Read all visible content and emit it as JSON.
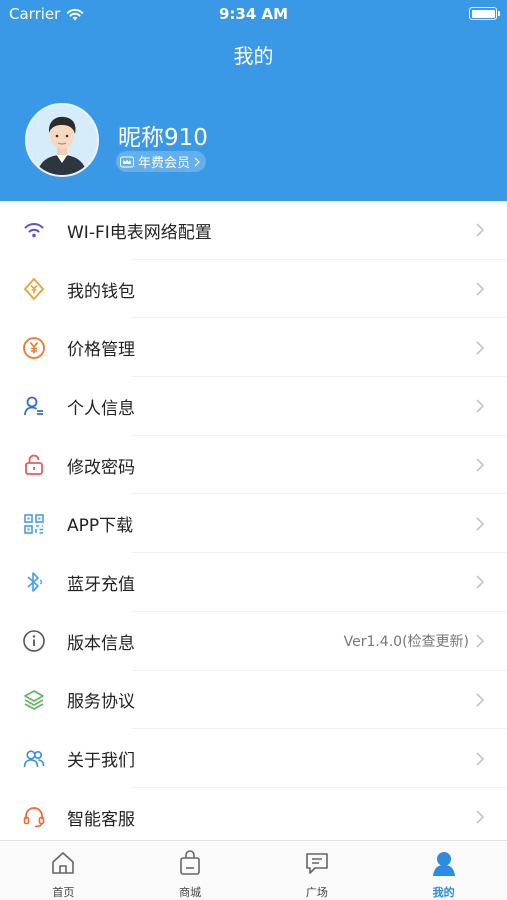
{
  "status_bar": {
    "carrier": "Carrier",
    "time": "9:34 AM"
  },
  "header": {
    "title": "我的"
  },
  "profile": {
    "nickname": "昵称910",
    "membership": "年费会员"
  },
  "menu": [
    {
      "label": "WI-FI电表网络配置",
      "icon": "wifi-icon",
      "right": ""
    },
    {
      "label": "我的钱包",
      "icon": "wallet-icon",
      "right": ""
    },
    {
      "label": "价格管理",
      "icon": "yen-icon",
      "right": ""
    },
    {
      "label": "个人信息",
      "icon": "user-info-icon",
      "right": ""
    },
    {
      "label": "修改密码",
      "icon": "lock-icon",
      "right": ""
    },
    {
      "label": "APP下载",
      "icon": "qrcode-icon",
      "right": ""
    },
    {
      "label": "蓝牙充值",
      "icon": "bluetooth-icon",
      "right": ""
    },
    {
      "label": "版本信息",
      "icon": "info-icon",
      "right": "Ver1.4.0(检查更新)"
    },
    {
      "label": "服务协议",
      "icon": "layers-icon",
      "right": ""
    },
    {
      "label": "关于我们",
      "icon": "group-icon",
      "right": ""
    },
    {
      "label": "智能客服",
      "icon": "headset-icon",
      "right": ""
    }
  ],
  "tabbar": [
    {
      "label": "首页",
      "icon": "home-icon",
      "active": false
    },
    {
      "label": "商城",
      "icon": "shopping-bag-icon",
      "active": false
    },
    {
      "label": "广场",
      "icon": "chat-icon",
      "active": false
    },
    {
      "label": "我的",
      "icon": "person-icon",
      "active": true
    }
  ],
  "colors": {
    "header": "#3a99e6",
    "active_tab": "#2d8ce0"
  }
}
